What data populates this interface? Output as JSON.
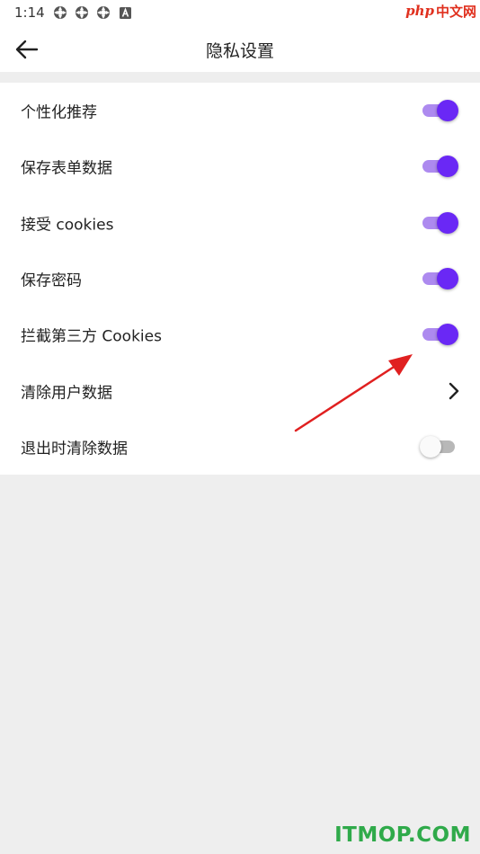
{
  "status_bar": {
    "time": "1:14",
    "icons": [
      "sync-icon",
      "sync-icon",
      "sync-icon",
      "a-icon"
    ]
  },
  "watermark_top": {
    "php": "php",
    "cn": "中文网"
  },
  "header": {
    "title": "隐私设置",
    "back_icon": "arrow-left-icon"
  },
  "settings": [
    {
      "label": "个性化推荐",
      "control": "toggle",
      "on": true
    },
    {
      "label": "保存表单数据",
      "control": "toggle",
      "on": true
    },
    {
      "label": "接受 cookies",
      "control": "toggle",
      "on": true
    },
    {
      "label": "保存密码",
      "control": "toggle",
      "on": true
    },
    {
      "label": "拦截第三方 Cookies",
      "control": "toggle",
      "on": true
    },
    {
      "label": "清除用户数据",
      "control": "chevron"
    },
    {
      "label": "退出时清除数据",
      "control": "toggle",
      "on": false
    }
  ],
  "colors": {
    "accent": "#6a28f5",
    "accent_track": "#ad8aef",
    "annotation": "#e02020",
    "watermark_green": "#2faa4a"
  },
  "watermark_bottom": "ITMOP.COM"
}
